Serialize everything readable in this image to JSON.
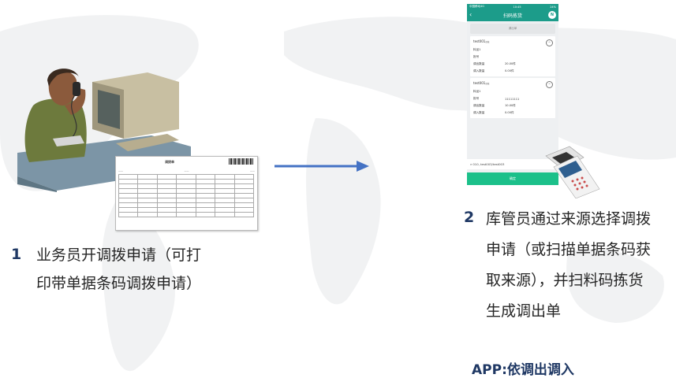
{
  "step1": {
    "number": "1",
    "lines": [
      "业务员开调拨申请（可打",
      "印带单据条码调拨申请）"
    ]
  },
  "step2": {
    "number": "2",
    "lines": [
      "库管员通过来源选择调拨",
      "申请（或扫描单据条码获",
      "取来源），并扫料码拣货",
      "生成调出单"
    ]
  },
  "app_label": "APP:依调出调入",
  "document": {
    "title": "调拨单",
    "headers": [
      "",
      "",
      "",
      "",
      "",
      "",
      ""
    ],
    "row": [
      "",
      "",
      "",
      "",
      "",
      "",
      ""
    ]
  },
  "phone": {
    "status_left": "中国移动4G",
    "status_time": "10:45",
    "status_right": "24%",
    "title": "扫码拣货",
    "subhead": "调出单",
    "cards": [
      {
        "code": "test001",
        "sub": "调拨",
        "rows": [
          {
            "k": "料品1",
            "v": ""
          },
          {
            "k": "批号",
            "v": ""
          },
          {
            "k": "调出数量",
            "v": "20.00件"
          },
          {
            "k": "调入数量",
            "v": "0.00件"
          }
        ]
      },
      {
        "code": "test001",
        "sub": "调拨",
        "rows": [
          {
            "k": "料品1",
            "v": ""
          },
          {
            "k": "批号",
            "v": "11111111"
          },
          {
            "k": "调出数量",
            "v": "10.00件"
          },
          {
            "k": "调入数量",
            "v": "0.00件"
          }
        ]
      }
    ],
    "scan_value": "010, test003/test003",
    "confirm_label": "确定"
  },
  "colors": {
    "accent_dark_blue": "#1f3864",
    "arrow_blue": "#4472c4",
    "phone_teal": "#1c9c8a",
    "confirm_green": "#1cc08a"
  }
}
